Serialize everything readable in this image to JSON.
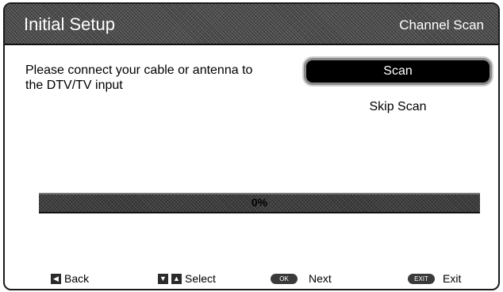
{
  "header": {
    "title": "Initial Setup",
    "section": "Channel Scan"
  },
  "instructions": "Please connect your cable or antenna to the DTV/TV input",
  "buttons": {
    "scan": "Scan",
    "skip": "Skip Scan"
  },
  "progress": {
    "label": "0%",
    "value_percent": 0
  },
  "footer": {
    "back": {
      "label": "Back",
      "key_icon": "left-arrow-icon"
    },
    "select": {
      "label": "Select",
      "key_icons": [
        "down-arrow-icon",
        "up-arrow-icon"
      ]
    },
    "next": {
      "label": "Next",
      "key_text": "OK"
    },
    "exit": {
      "label": "Exit",
      "key_text": "EXIT"
    }
  }
}
